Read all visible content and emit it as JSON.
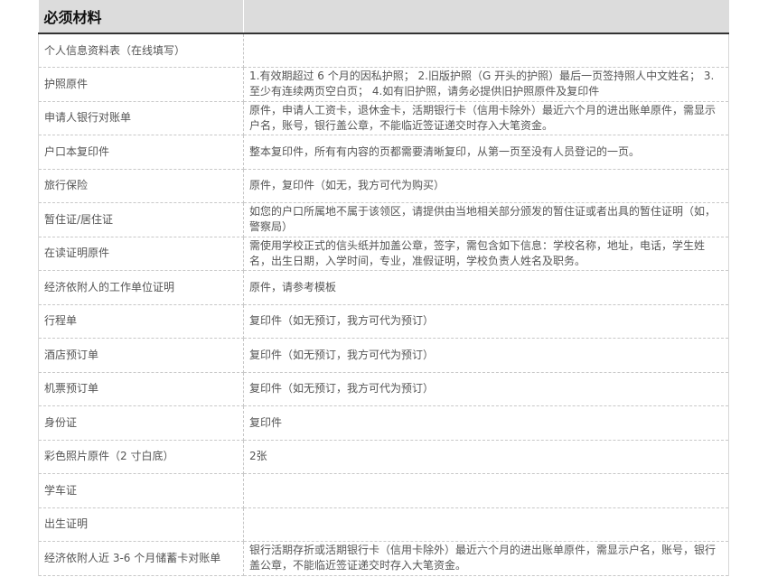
{
  "table": {
    "header": "必须材料",
    "rows": [
      {
        "label": "个人信息资料表（在线填写）",
        "value": ""
      },
      {
        "label": "护照原件",
        "value": "1.有效期超过 6 个月的因私护照； 2.旧版护照（G 开头的护照）最后一页签持照人中文姓名； 3.至少有连续两页空白页； 4.如有旧护照，请务必提供旧护照原件及复印件"
      },
      {
        "label": "申请人银行对账单",
        "value": "原件，申请人工资卡，退休金卡，活期银行卡（信用卡除外）最近六个月的进出账单原件，需显示户名，账号，银行盖公章，不能临近签证递交时存入大笔资金。"
      },
      {
        "label": "户口本复印件",
        "value": "整本复印件，所有有内容的页都需要清晰复印，从第一页至没有人员登记的一页。"
      },
      {
        "label": "旅行保险",
        "value": "原件，复印件（如无，我方可代为购买）"
      },
      {
        "label": "暂住证/居住证",
        "value": "如您的户口所属地不属于该领区，请提供由当地相关部分颁发的暂住证或者出具的暂住证明（如，警察局）"
      },
      {
        "label": "在读证明原件",
        "value": "需使用学校正式的信头纸并加盖公章，签字，需包含如下信息：学校名称，地址，电话，学生姓名，出生日期，入学时间，专业，准假证明，学校负责人姓名及职务。"
      },
      {
        "label": "经济依附人的工作单位证明",
        "value": "原件，请参考模板"
      },
      {
        "label": "行程单",
        "value": "复印件（如无预订，我方可代为预订）"
      },
      {
        "label": "酒店预订单",
        "value": "复印件（如无预订，我方可代为预订）"
      },
      {
        "label": "机票预订单",
        "value": "复印件（如无预订，我方可代为预订）"
      },
      {
        "label": "身份证",
        "value": "复印件"
      },
      {
        "label": "彩色照片原件（2 寸白底）",
        "value": "2张"
      },
      {
        "label": "学车证",
        "value": ""
      },
      {
        "label": "出生证明",
        "value": ""
      },
      {
        "label": "经济依附人近 3-6 个月储蓄卡对账单",
        "value": "银行活期存折或活期银行卡（信用卡除外）最近六个月的进出账单原件，需显示户名，账号，银行盖公章，不能临近签证递交时存入大笔资金。"
      }
    ]
  }
}
